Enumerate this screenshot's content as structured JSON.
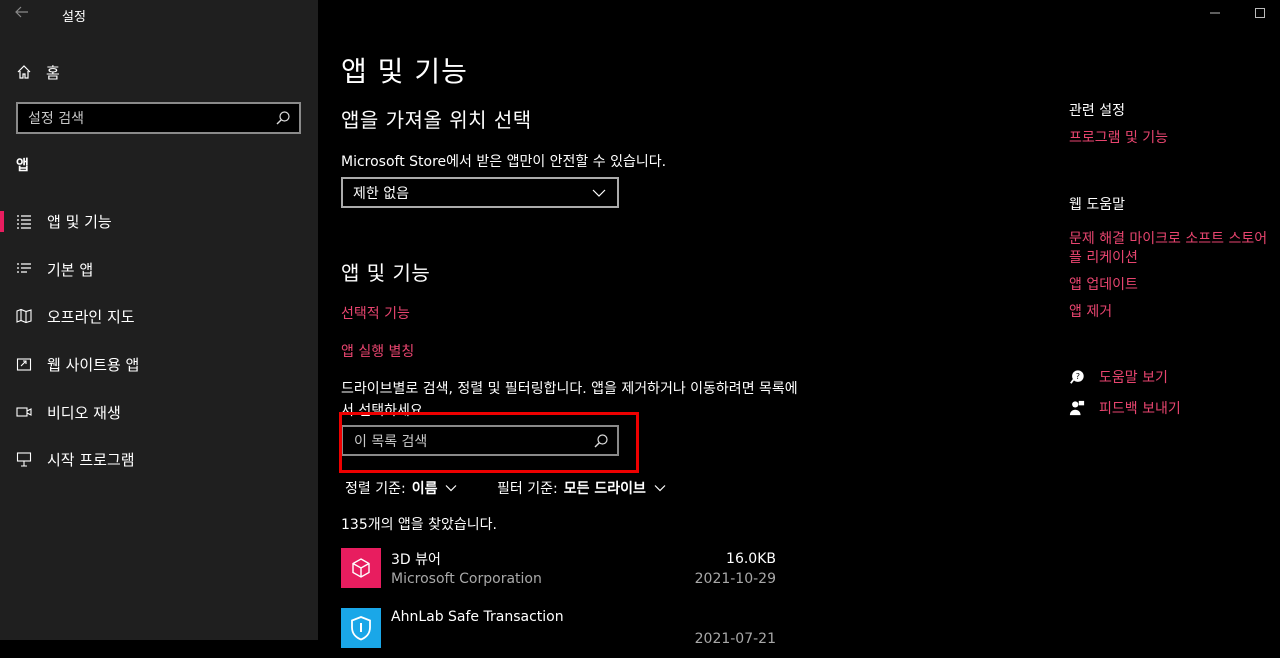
{
  "window": {
    "title": "설정"
  },
  "sidebar": {
    "home_label": "홈",
    "search_placeholder": "설정 검색",
    "section_label": "앱",
    "items": [
      {
        "label": "앱 및 기능",
        "icon": "apps-list-icon",
        "selected": true
      },
      {
        "label": "기본 앱",
        "icon": "default-apps-icon"
      },
      {
        "label": "오프라인 지도",
        "icon": "offline-maps-icon"
      },
      {
        "label": "웹 사이트용 앱",
        "icon": "apps-for-websites-icon"
      },
      {
        "label": "비디오 재생",
        "icon": "video-playback-icon"
      },
      {
        "label": "시작 프로그램",
        "icon": "startup-icon"
      }
    ]
  },
  "main": {
    "title": "앱 및 기능",
    "install_source": {
      "heading": "앱을 가져올 위치 선택",
      "description": "Microsoft Store에서 받은 앱만이 안전할 수 있습니다.",
      "selected": "제한 없음"
    },
    "apps_features": {
      "heading": "앱 및 기능",
      "link_optional": "선택적 기능",
      "link_aliases": "앱 실행 별칭",
      "description": "드라이브별로 검색, 정렬 및 필터링합니다. 앱을 제거하거나 이동하려면 목록에서 선택하세요.",
      "search_placeholder": "이 목록 검색",
      "sort_label": "정렬 기준:",
      "sort_value": "이름",
      "filter_label": "필터 기준:",
      "filter_value": "모든 드라이브",
      "count_text": "135개의 앱을 찾았습니다."
    },
    "apps": [
      {
        "name": "3D 뷰어",
        "publisher": "Microsoft Corporation",
        "size": "16.0KB",
        "date": "2021-10-29",
        "icon": "3d-viewer-icon",
        "color": "#e81d5f"
      },
      {
        "name": "AhnLab Safe Transaction",
        "publisher": "",
        "size": "",
        "date": "2021-07-21",
        "icon": "ahnlab-shield-icon",
        "color": "#1aa7e8"
      }
    ]
  },
  "right": {
    "related_heading": "관련 설정",
    "related_link": "프로그램 및 기능",
    "web_help_heading": "웹 도움말",
    "web_help_links": [
      "문제 해결 마이크로 소프트 스토어",
      "플 리케이션",
      "앱 업데이트",
      "앱 제거"
    ],
    "help_label": "도움말 보기",
    "feedback_label": "피드백 보내기"
  },
  "colors": {
    "accent": "#e81d5f",
    "highlight_box": "#e00000"
  }
}
